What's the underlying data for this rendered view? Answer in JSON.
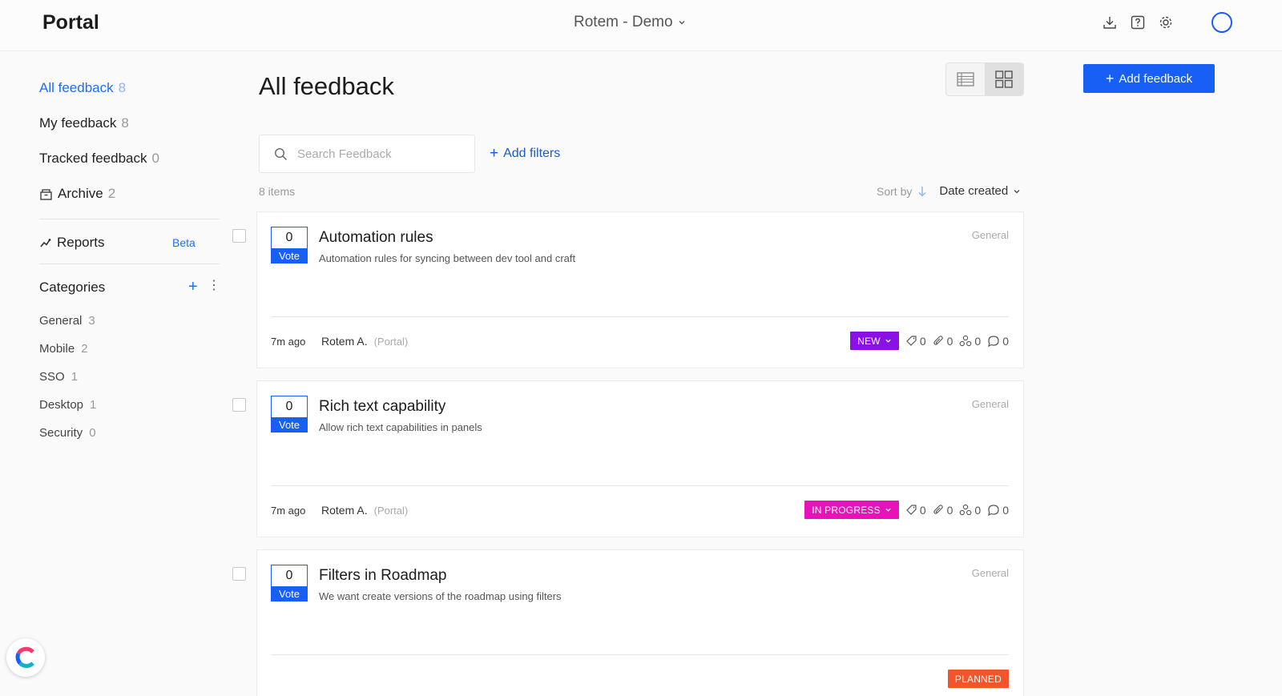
{
  "app": {
    "logo": "Portal",
    "workspace": "Rotem - Demo"
  },
  "sidebar": {
    "nav": [
      {
        "label": "All feedback",
        "count": "8"
      },
      {
        "label": "My feedback",
        "count": "8"
      },
      {
        "label": "Tracked feedback",
        "count": "0"
      },
      {
        "label": "Archive",
        "count": "2"
      }
    ],
    "reports": {
      "label": "Reports",
      "badge": "Beta"
    },
    "categories_title": "Categories",
    "categories": [
      {
        "label": "General",
        "count": "3"
      },
      {
        "label": "Mobile",
        "count": "2"
      },
      {
        "label": "SSO",
        "count": "1"
      },
      {
        "label": "Desktop",
        "count": "1"
      },
      {
        "label": "Security",
        "count": "0"
      }
    ]
  },
  "main": {
    "title": "All feedback",
    "add_button": "Add feedback",
    "search_placeholder": "Search Feedback",
    "add_filters": "Add filters",
    "items_count": "8 items",
    "sort_label": "Sort by",
    "sort_value": "Date created"
  },
  "cards": [
    {
      "votes": "0",
      "vote_label": "Vote",
      "title": "Automation rules",
      "description": "Automation rules for syncing between dev tool and craft",
      "category": "General",
      "time": "7m ago",
      "author": "Rotem A.",
      "source": "(Portal)",
      "status": "NEW",
      "status_color": "#8a10e8",
      "tags": "0",
      "attachments": "0",
      "links": "0",
      "comments": "0"
    },
    {
      "votes": "0",
      "vote_label": "Vote",
      "title": "Rich text capability",
      "description": "Allow rich text capabilities in panels",
      "category": "General",
      "time": "7m ago",
      "author": "Rotem A.",
      "source": "(Portal)",
      "status": "IN PROGRESS",
      "status_color": "#e812b8",
      "tags": "0",
      "attachments": "0",
      "links": "0",
      "comments": "0"
    },
    {
      "votes": "0",
      "vote_label": "Vote",
      "title": "Filters in Roadmap",
      "description": "We want create versions of the roadmap using filters",
      "category": "General",
      "time": "",
      "author": "",
      "source": "",
      "status": "PLANNED",
      "status_color": "#f2552c",
      "tags": "",
      "attachments": "",
      "links": "",
      "comments": ""
    }
  ],
  "colors": {
    "accent": "#1860f5",
    "new": "#8a10e8",
    "in_progress": "#e812b8",
    "planned": "#f2552c"
  },
  "icons": [
    "download-icon",
    "help-icon",
    "gear-icon",
    "avatar",
    "search-icon",
    "table-view-icon",
    "grid-view-icon",
    "archive-icon",
    "reports-icon",
    "tag-icon",
    "paperclip-icon",
    "link-icon",
    "comment-icon",
    "chat-widget-icon"
  ]
}
